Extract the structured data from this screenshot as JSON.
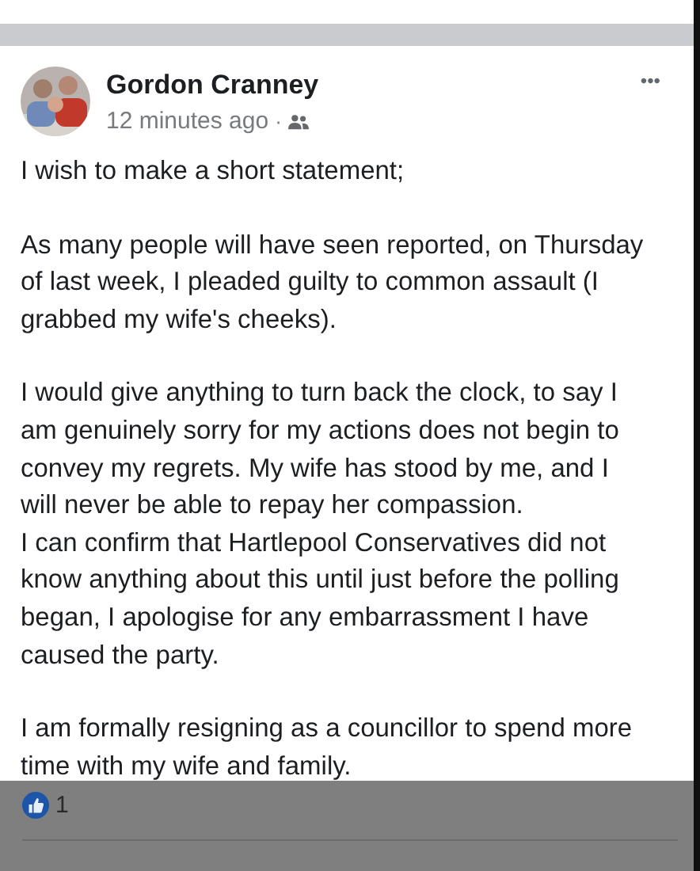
{
  "post": {
    "author": "Gordon Cranney",
    "time": "12 minutes ago",
    "separator": "·",
    "menu": "•••",
    "sections": [
      [
        "I wish to make a short statement;"
      ],
      [
        "As many people will have seen reported, on Thursday of last week, I pleaded guilty to common assault (I grabbed my wife's cheeks)."
      ],
      [
        "I would give anything to turn back the clock, to say I am genuinely sorry for my actions does not begin to convey my regrets. My wife has stood by me, and I will never be able to repay her compassion.",
        "I can confirm that Hartlepool Conservatives did not know anything about this until just before the polling began, I apologise for any embarrassment I have caused the party."
      ],
      [
        "I am formally resigning as a councillor to spend more time with my wife and family."
      ]
    ]
  },
  "reactions": {
    "count": "1"
  }
}
